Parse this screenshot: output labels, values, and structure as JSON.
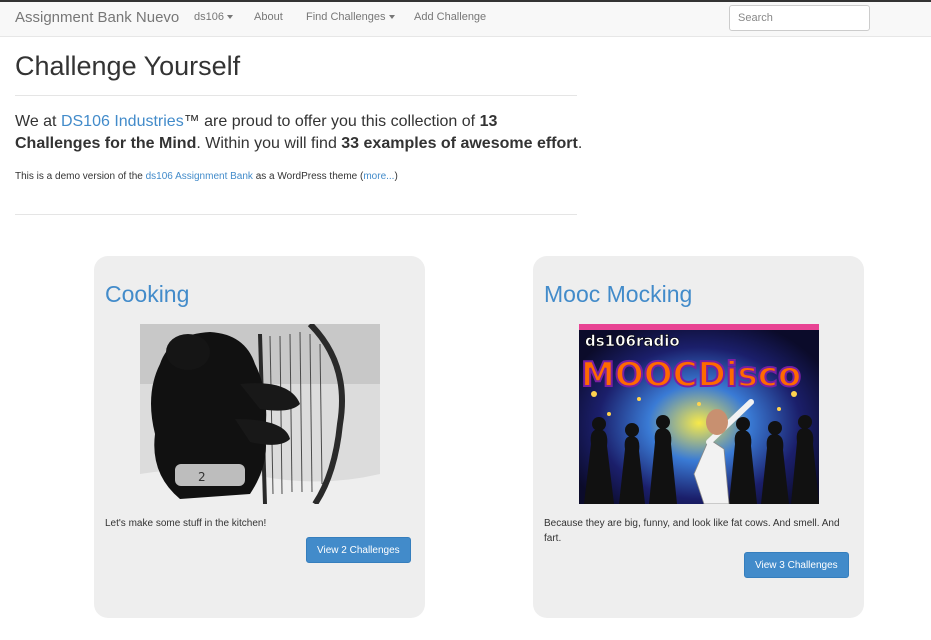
{
  "navbar": {
    "brand": "Assignment Bank Nuevo",
    "items": [
      {
        "label": "ds106",
        "dropdown": true
      },
      {
        "label": "About",
        "dropdown": false
      },
      {
        "label": "Find Challenges",
        "dropdown": true
      },
      {
        "label": "Add Challenge",
        "dropdown": false
      }
    ],
    "search_placeholder": "Search"
  },
  "page": {
    "title": "Challenge Yourself",
    "lead": {
      "t1": "We at ",
      "link": "DS106 Industries",
      "t2": "™ are proud to offer you this collection of ",
      "b1": "13 Challenges for the Mind",
      "t3": ". Within you will find ",
      "b2": "33 examples of awesome effort",
      "t4": "."
    },
    "demo": {
      "t1": "This is a demo version of the ",
      "link": "ds106 Assignment Bank",
      "t2": " as a WordPress theme (",
      "more": "more...",
      "t3": ")"
    }
  },
  "cards": [
    {
      "title": "Cooking",
      "description": "Let's make some stuff in the kitchen!",
      "button": "View 2 Challenges"
    },
    {
      "title": "Mooc Mocking",
      "image_text_top": "ds106radio",
      "image_text_main": "MOOCDisco",
      "description": "Because they are big, funny, and look like fat cows. And smell. And fart.",
      "button": "View 3 Challenges"
    }
  ],
  "colors": {
    "accent": "#428bca",
    "card_bg": "#eeeeee",
    "navbar_bg": "#f8f8f8"
  }
}
